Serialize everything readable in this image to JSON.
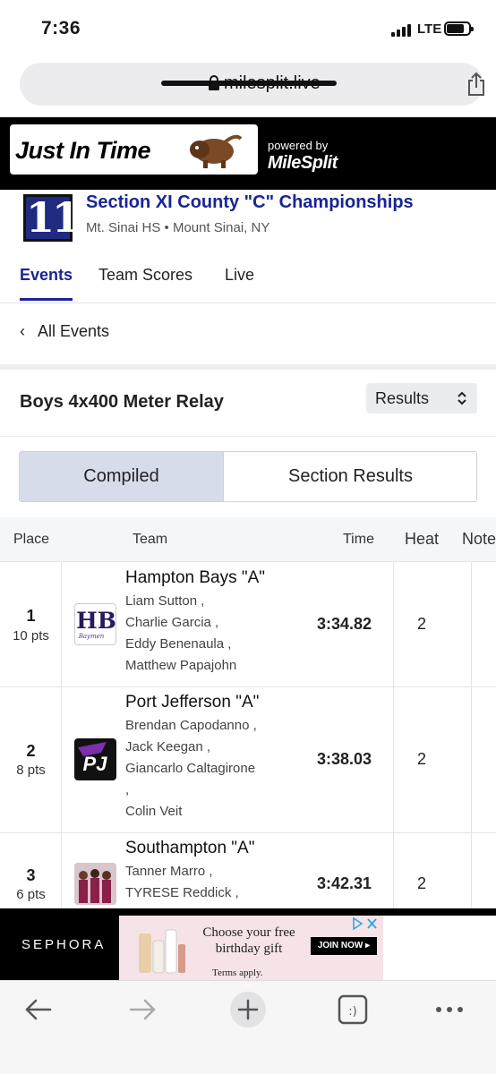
{
  "status": {
    "time": "7:36",
    "network": "LTE"
  },
  "browser": {
    "url": "milesplit.live"
  },
  "banner": {
    "brand": "Just In Time",
    "powered_by": "powered by",
    "partner": "MileSplit"
  },
  "meet": {
    "logo_text": "11",
    "title": "Section XI County \"C\" Championships",
    "subtitle": "Mt. Sinai HS • Mount Sinai, NY"
  },
  "nav": {
    "tabs": [
      "Events",
      "Team Scores",
      "Live"
    ],
    "active": "Events"
  },
  "back": {
    "label": "All Events"
  },
  "event": {
    "title": "Boys 4x400 Meter Relay",
    "view_select": "Results"
  },
  "toggle": {
    "options": [
      "Compiled",
      "Section Results"
    ],
    "active": "Compiled"
  },
  "table": {
    "headers": {
      "place": "Place",
      "team": "Team",
      "time": "Time",
      "heat": "Heat",
      "note": "Note"
    },
    "rows": [
      {
        "place": "1",
        "points": "10 pts",
        "team": "Hampton Bays \"A\"",
        "athletes": [
          "Liam Sutton ,",
          "Charlie Garcia ,",
          "Eddy Benenaula ,",
          "Matthew Papajohn"
        ],
        "time": "3:34.82",
        "heat": "2",
        "logo_text": "HB",
        "logo_script": "Baymen"
      },
      {
        "place": "2",
        "points": "8 pts",
        "team": "Port Jefferson \"A\"",
        "athletes": [
          "Brendan Capodanno ,",
          "Jack Keegan ,",
          "Giancarlo Caltagirone",
          ",",
          "Colin Veit"
        ],
        "time": "3:38.03",
        "heat": "2",
        "logo_text": "PJ"
      },
      {
        "place": "3",
        "points": "6 pts",
        "team": "Southampton \"A\"",
        "athletes": [
          "Tanner Marro ,",
          "TYRESE Reddick ,"
        ],
        "time": "3:42.31",
        "heat": "2"
      }
    ]
  },
  "ad": {
    "advertiser": "SEPHORA",
    "message": "Choose your free birthday gift",
    "cta": "JOIN NOW ▸",
    "terms": "Terms apply."
  },
  "colors": {
    "brand_blue": "#1a2496",
    "logo_navy": "#1f2a80",
    "pj_purple": "#7b2fa8"
  }
}
